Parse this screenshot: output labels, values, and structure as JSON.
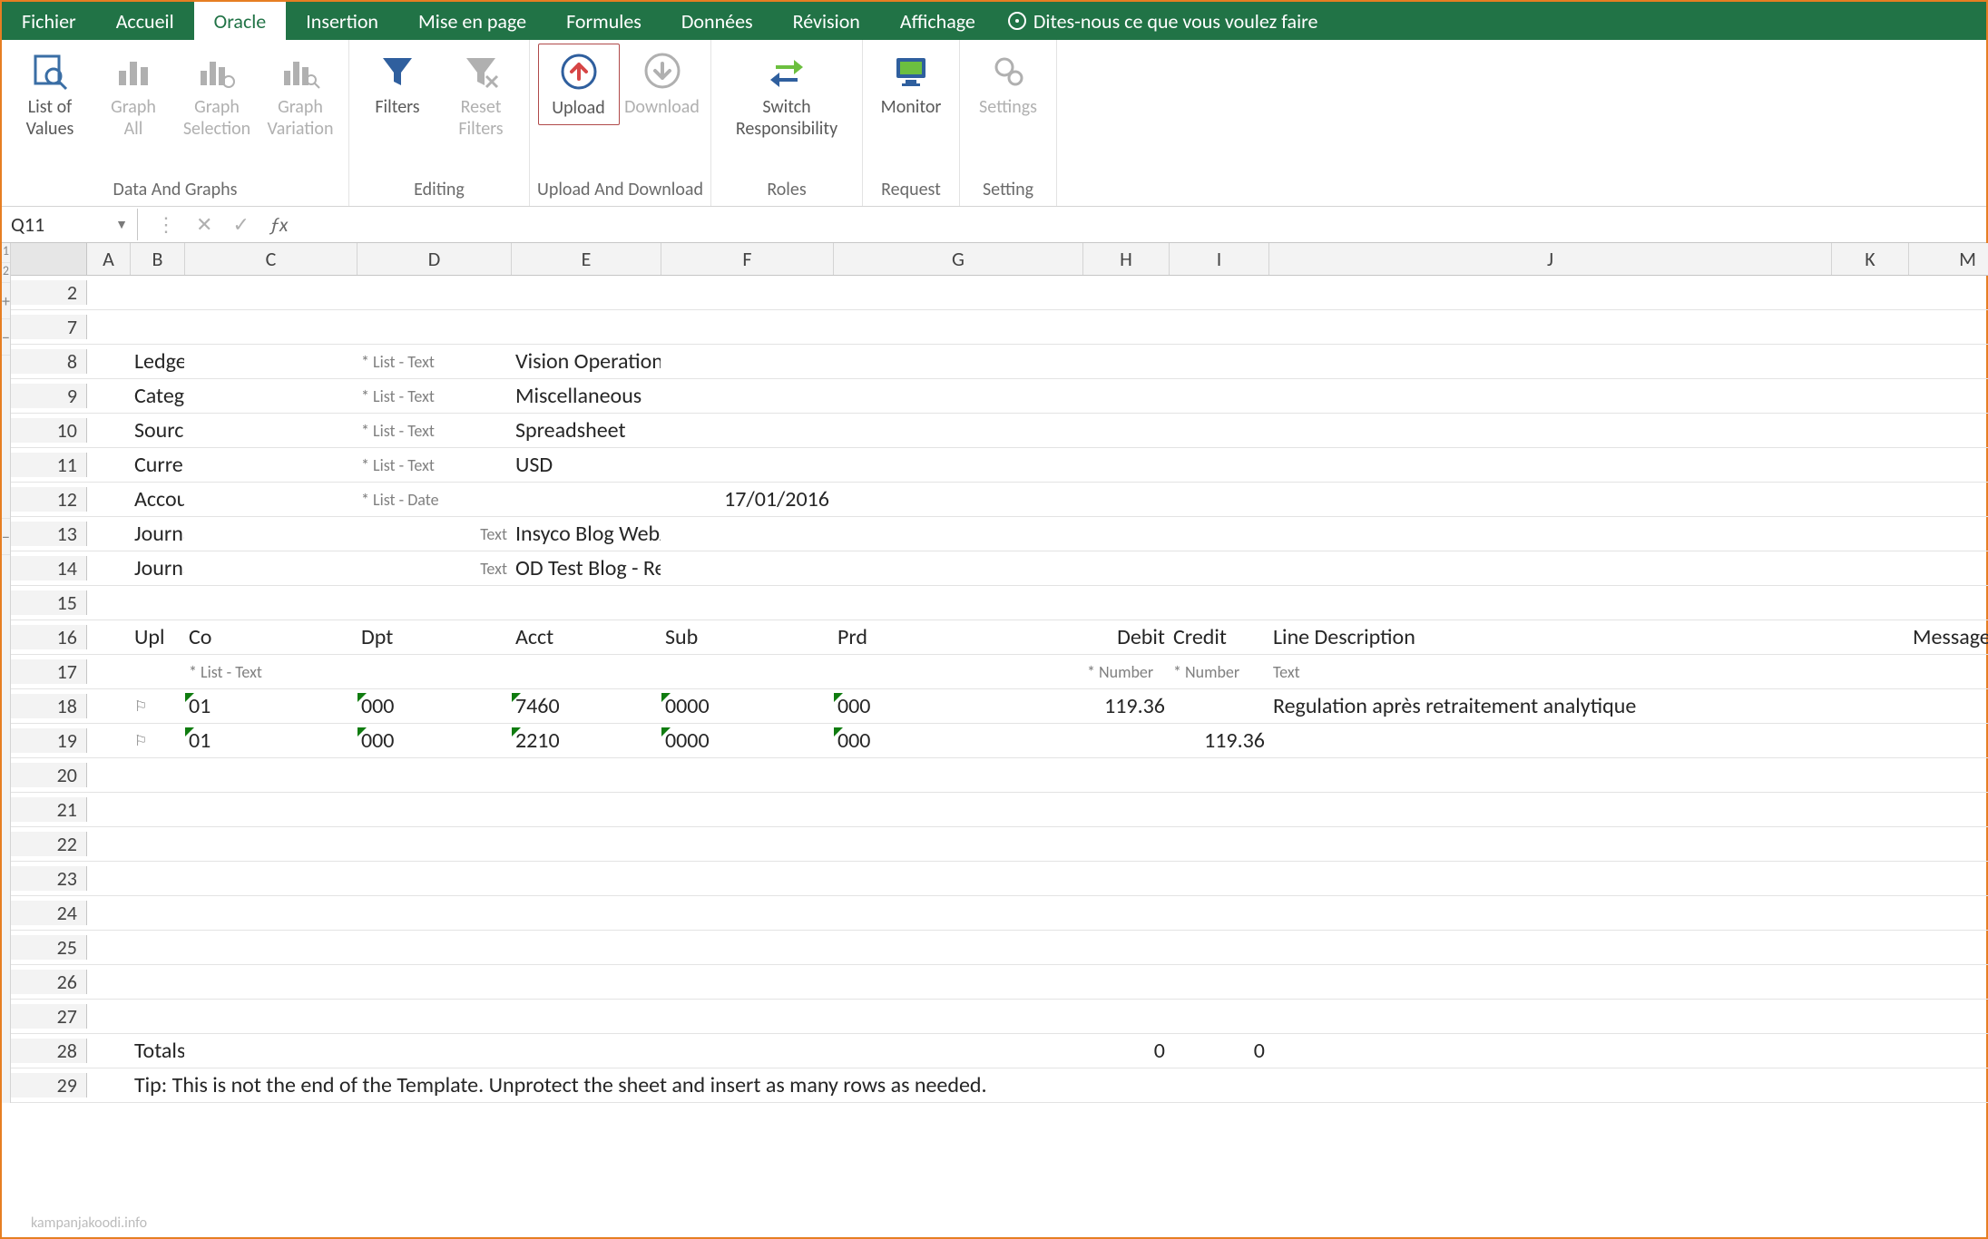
{
  "menu": {
    "items": [
      "Fichier",
      "Accueil",
      "Oracle",
      "Insertion",
      "Mise en page",
      "Formules",
      "Données",
      "Révision",
      "Affichage"
    ],
    "active_index": 2,
    "tellme": "Dites-nous ce que vous voulez faire"
  },
  "ribbon": {
    "groups": [
      {
        "label": "Data And Graphs",
        "buttons": [
          {
            "name": "list-of-values",
            "label": "List of\nValues",
            "dim": false,
            "icon": "search"
          },
          {
            "name": "graph-all",
            "label": "Graph\nAll",
            "dim": true,
            "icon": "bar"
          },
          {
            "name": "graph-selection",
            "label": "Graph\nSelection",
            "dim": true,
            "icon": "bar-gear"
          },
          {
            "name": "graph-variation",
            "label": "Graph\nVariation",
            "dim": true,
            "icon": "bar-search"
          }
        ]
      },
      {
        "label": "Editing",
        "buttons": [
          {
            "name": "filters",
            "label": "Filters",
            "dim": false,
            "icon": "funnel"
          },
          {
            "name": "reset-filters",
            "label": "Reset\nFilters",
            "dim": true,
            "icon": "funnel-x"
          }
        ]
      },
      {
        "label": "Upload And Download",
        "buttons": [
          {
            "name": "upload",
            "label": "Upload",
            "dim": false,
            "icon": "upload",
            "selected": true
          },
          {
            "name": "download",
            "label": "Download",
            "dim": true,
            "icon": "download"
          }
        ]
      },
      {
        "label": "Roles",
        "buttons": [
          {
            "name": "switch-responsibility",
            "label": "Switch\nResponsibility",
            "dim": false,
            "icon": "switch"
          }
        ]
      },
      {
        "label": "Request",
        "buttons": [
          {
            "name": "monitor",
            "label": "Monitor",
            "dim": false,
            "icon": "monitor"
          }
        ]
      },
      {
        "label": "Setting",
        "buttons": [
          {
            "name": "settings",
            "label": "Settings",
            "dim": true,
            "icon": "gear"
          }
        ]
      }
    ]
  },
  "namebox": "Q11",
  "columns": [
    "A",
    "B",
    "C",
    "D",
    "E",
    "F",
    "G",
    "H",
    "I",
    "J",
    "K",
    "M"
  ],
  "row_numbers": [
    2,
    7,
    8,
    9,
    10,
    11,
    12,
    13,
    14,
    15,
    16,
    17,
    18,
    19,
    20,
    21,
    22,
    23,
    24,
    25,
    26,
    27,
    28,
    29
  ],
  "header_block": {
    "fields": [
      {
        "label": "Ledger",
        "hint": "* List - Text",
        "value": "Vision Operations (USA)"
      },
      {
        "label": "Category",
        "hint": "* List - Text",
        "value": "Miscellaneous"
      },
      {
        "label": "Source",
        "hint": "* List - Text",
        "value": "Spreadsheet"
      },
      {
        "label": "Currency",
        "hint": "* List - Text",
        "value": "USD"
      },
      {
        "label": "Accounting Date",
        "hint": "* List - Date",
        "value": "17/01/2016",
        "value_col": "F"
      },
      {
        "label": "Journal Description",
        "hint": "Text",
        "value": "Insyco Blog WebADI OD"
      },
      {
        "label": "Journal Reference",
        "hint": "Text",
        "value": "OD Test Blog - Reel"
      }
    ]
  },
  "line_headers": {
    "Upl": "Upl",
    "Co": "Co",
    "Dpt": "Dpt",
    "Acct": "Acct",
    "Sub": "Sub",
    "Prd": "Prd",
    "Debit": "Debit",
    "Credit": "Credit",
    "LineDesc": "Line Description",
    "Messages": "Messages"
  },
  "line_hints": {
    "Co": "* List - Text",
    "Debit": "* Number",
    "Credit": "* Number",
    "LineDesc": "Text"
  },
  "lines": [
    {
      "flag": "⚐",
      "Co": "01",
      "Dpt": "000",
      "Acct": "7460",
      "Sub": "0000",
      "Prd": "000",
      "Debit": "119.36",
      "Credit": "",
      "LineDesc": "Regulation après retraitement analytique"
    },
    {
      "flag": "⚐",
      "Co": "01",
      "Dpt": "000",
      "Acct": "2210",
      "Sub": "0000",
      "Prd": "000",
      "Debit": "",
      "Credit": "119.36",
      "LineDesc": ""
    }
  ],
  "totals": {
    "label": "Totals:",
    "debit": "0",
    "credit": "0"
  },
  "tip": "Tip: This is not the end of the Template.  Unprotect the sheet and insert as many rows as needed.",
  "watermark": "kampanjakoodi.info"
}
